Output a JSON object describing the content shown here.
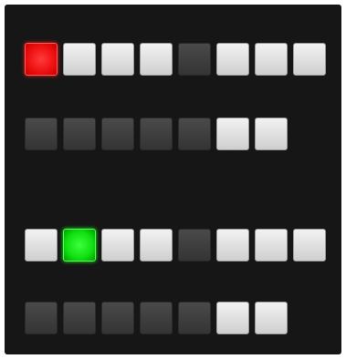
{
  "program": {
    "label": "",
    "row1": [
      {
        "state": "red",
        "label": ""
      },
      {
        "state": "active",
        "label": ""
      },
      {
        "state": "active",
        "label": ""
      },
      {
        "state": "active",
        "label": ""
      },
      {
        "state": "inactive",
        "label": ""
      },
      {
        "state": "active",
        "label": ""
      },
      {
        "state": "active",
        "label": ""
      },
      {
        "state": "active",
        "label": ""
      }
    ],
    "row2": [
      {
        "state": "inactive",
        "label": ""
      },
      {
        "state": "inactive",
        "label": ""
      },
      {
        "state": "inactive",
        "label": ""
      },
      {
        "state": "inactive",
        "label": ""
      },
      {
        "state": "inactive",
        "label": ""
      },
      {
        "state": "active",
        "label": ""
      },
      {
        "state": "active",
        "label": ""
      }
    ]
  },
  "preview": {
    "label": "",
    "row1": [
      {
        "state": "active",
        "label": ""
      },
      {
        "state": "green",
        "label": ""
      },
      {
        "state": "active",
        "label": ""
      },
      {
        "state": "active",
        "label": ""
      },
      {
        "state": "inactive",
        "label": ""
      },
      {
        "state": "active",
        "label": ""
      },
      {
        "state": "active",
        "label": ""
      },
      {
        "state": "active",
        "label": ""
      }
    ],
    "row2": [
      {
        "state": "inactive",
        "label": ""
      },
      {
        "state": "inactive",
        "label": ""
      },
      {
        "state": "inactive",
        "label": ""
      },
      {
        "state": "inactive",
        "label": ""
      },
      {
        "state": "inactive",
        "label": ""
      },
      {
        "state": "active",
        "label": ""
      },
      {
        "state": "active",
        "label": ""
      }
    ]
  },
  "colors": {
    "panel_bg": "#161616",
    "program_tally": "#ee1010",
    "preview_tally": "#10e010",
    "button_active": "#e6e6e6",
    "button_inactive": "#3c3c3c"
  }
}
